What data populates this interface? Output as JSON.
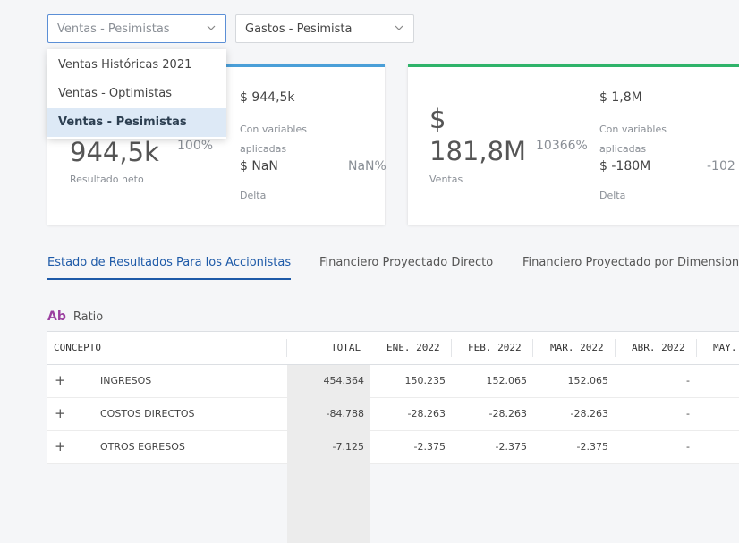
{
  "filters": {
    "ventas_selected": "Ventas - Pesimistas",
    "gastos_selected": "Gastos - Pesimista",
    "ventas_options": [
      "Ventas Históricas 2021",
      "Ventas - Optimistas",
      "Ventas - Pesimistas"
    ]
  },
  "card1": {
    "big_value": "944,5k",
    "big_caption": "Resultado neto",
    "big_pct": "100%",
    "right_value": "$ 944,5k",
    "right_caption": "Con variables aplicadas",
    "delta_value": "$ NaN",
    "delta_pct": "NaN%",
    "delta_caption": "Delta"
  },
  "card2": {
    "currency": "$",
    "big_value": "181,8M",
    "big_caption": "Ventas",
    "big_pct": "10366%",
    "right_value": "$ 1,8M",
    "right_caption": "Con variables aplicadas",
    "delta_value": "$ -180M",
    "delta_pct": "-102",
    "delta_caption": "Delta"
  },
  "tabs": [
    "Estado de Resultados Para los Accionistas",
    "Financiero Proyectado Directo",
    "Financiero Proyectado por Dimension"
  ],
  "ratio": {
    "icon": "Ab",
    "label": "Ratio"
  },
  "table": {
    "headers": [
      "CONCEPTO",
      "TOTAL",
      "ENE. 2022",
      "FEB. 2022",
      "MAR. 2022",
      "ABR. 2022",
      "MAY."
    ],
    "rows": [
      {
        "name": "INGRESOS",
        "values": [
          "454.364",
          "150.235",
          "152.065",
          "152.065",
          "-"
        ]
      },
      {
        "name": "COSTOS DIRECTOS",
        "values": [
          "-84.788",
          "-28.263",
          "-28.263",
          "-28.263",
          "-"
        ]
      },
      {
        "name": "OTROS EGRESOS",
        "values": [
          "-7.125",
          "-2.375",
          "-2.375",
          "-2.375",
          "-"
        ]
      }
    ]
  },
  "colors": {
    "accent": "#1e5aa8",
    "card1_top": "#4a9fd8",
    "card2_top": "#2fb36a",
    "ratio_icon": "#9b3fa0"
  },
  "icons": {
    "select_chevron": "chevron-down-icon",
    "row_expand": "plus-icon"
  }
}
